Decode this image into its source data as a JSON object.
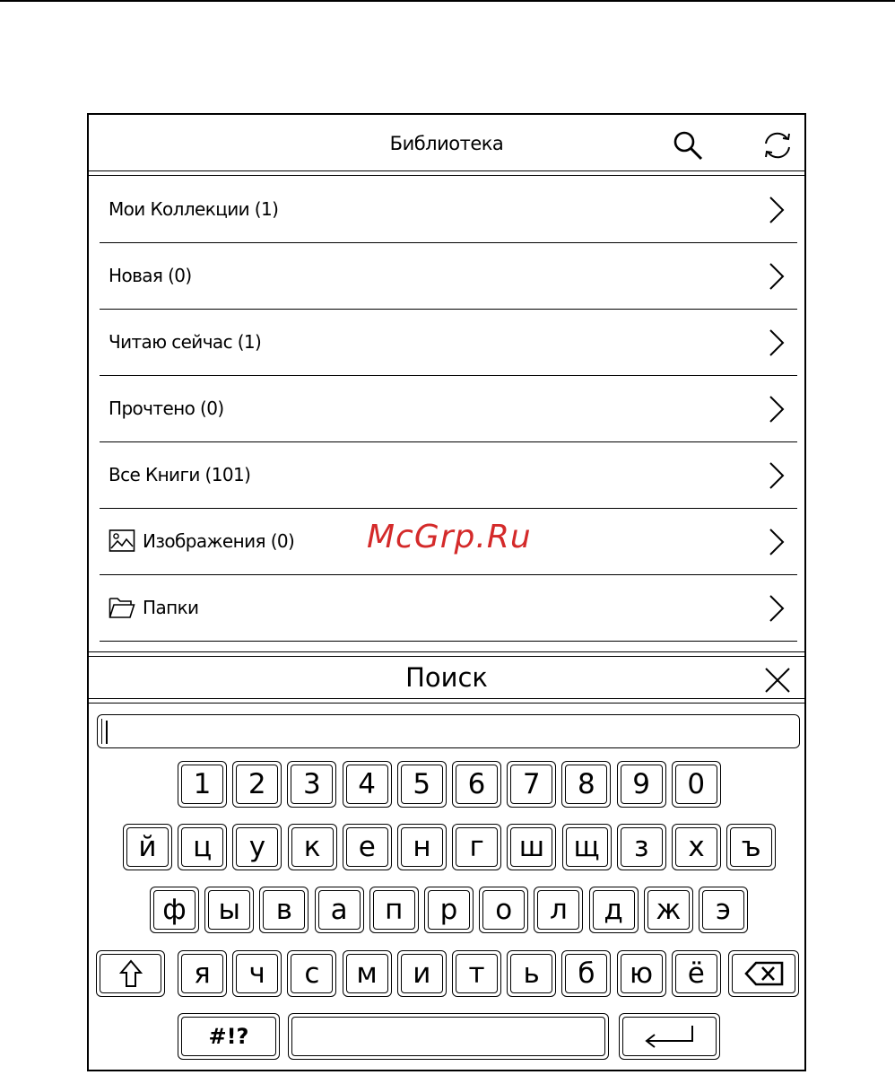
{
  "header": {
    "title": "Библиотека"
  },
  "icons": {
    "search": "search-icon",
    "sync": "sync-icon",
    "chevron": "chevron-right-icon",
    "image": "image-icon",
    "folder": "folder-icon",
    "close": "close-icon",
    "shift": "shift-icon",
    "backspace": "backspace-icon",
    "enter": "enter-icon"
  },
  "library": {
    "items": [
      {
        "label": "Мои Коллекции (1)"
      },
      {
        "label": "Новая (0)"
      },
      {
        "label": "Читаю сейчас (1)"
      },
      {
        "label": "Прочтено (0)"
      },
      {
        "label": "Все Книги (101)"
      },
      {
        "label": "Изображения (0)"
      },
      {
        "label": "Папки"
      }
    ]
  },
  "watermark": "McGrp.Ru",
  "search": {
    "title": "Поиск",
    "input_value": ""
  },
  "keyboard": {
    "row_digits": [
      "1",
      "2",
      "3",
      "4",
      "5",
      "6",
      "7",
      "8",
      "9",
      "0"
    ],
    "row1": [
      "й",
      "ц",
      "у",
      "к",
      "е",
      "н",
      "г",
      "ш",
      "щ",
      "з",
      "х",
      "ъ"
    ],
    "row2": [
      "ф",
      "ы",
      "в",
      "а",
      "п",
      "р",
      "о",
      "л",
      "д",
      "ж",
      "э"
    ],
    "row3": [
      "я",
      "ч",
      "с",
      "м",
      "и",
      "т",
      "ь",
      "б",
      "ю",
      "ё"
    ],
    "symbols": "#!?"
  }
}
